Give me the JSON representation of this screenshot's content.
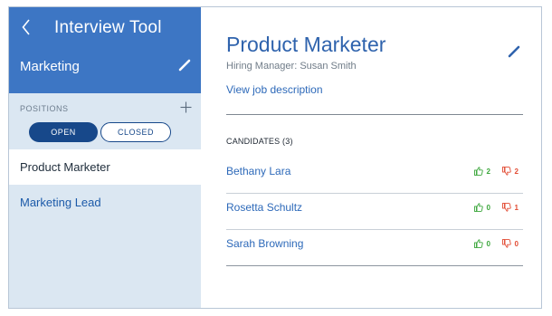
{
  "sidebar": {
    "app_title": "Interview Tool",
    "department": "Marketing",
    "positions_label": "POSITIONS",
    "filters": {
      "open": "OPEN",
      "closed": "CLOSED",
      "selected": "open"
    },
    "positions": [
      {
        "label": "Product Marketer",
        "active": true
      },
      {
        "label": "Marketing Lead",
        "active": false
      }
    ]
  },
  "main": {
    "job_title": "Product Marketer",
    "hiring_manager": "Hiring Manager: Susan Smith",
    "view_description": "View job description",
    "candidates_label": "CANDIDATES (3)",
    "candidates": [
      {
        "name": "Bethany Lara",
        "up": "2",
        "down": "2"
      },
      {
        "name": "Rosetta Schultz",
        "up": "0",
        "down": "1"
      },
      {
        "name": "Sarah Browning",
        "up": "0",
        "down": "0"
      }
    ]
  },
  "colors": {
    "header_blue": "#3d76c4",
    "sidebar_bg": "#dbe7f2",
    "dark_navy": "#17488a",
    "link_blue": "#2d69b9",
    "thumb_up_green": "#3aa63a",
    "thumb_down_red": "#e24b33"
  },
  "icons": {
    "back": "chevron-left-icon",
    "edit": "pencil-icon",
    "add": "plus-icon",
    "upvote": "thumbs-up-icon",
    "downvote": "thumbs-down-icon"
  }
}
